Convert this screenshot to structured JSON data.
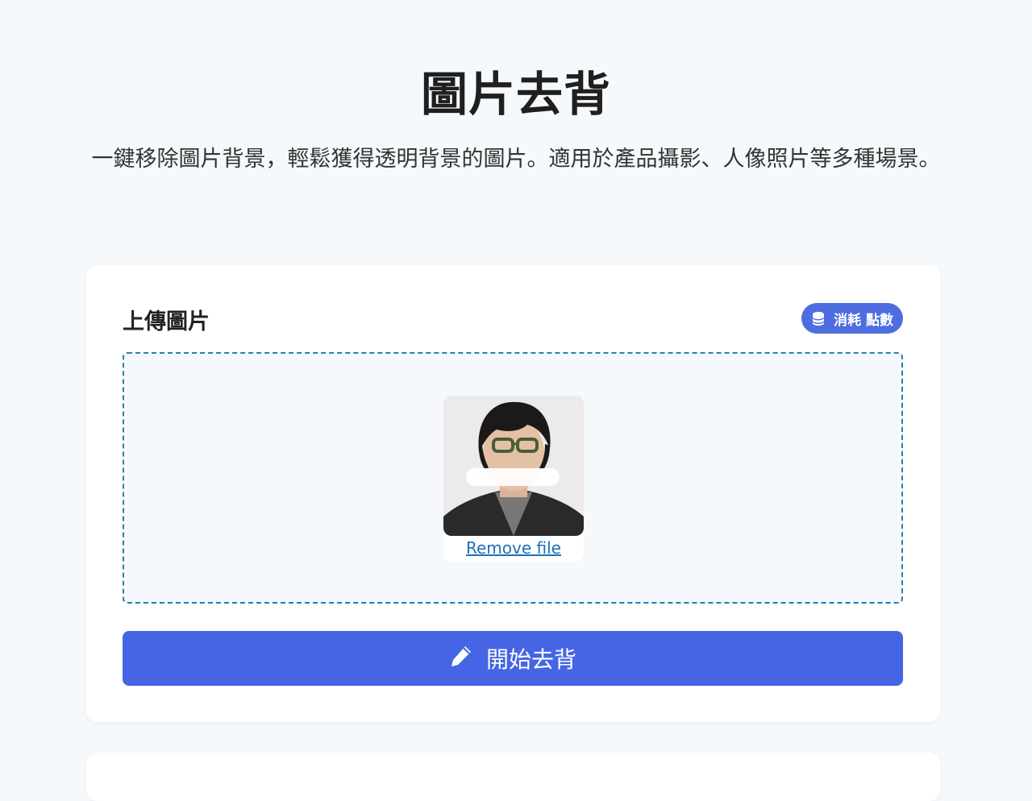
{
  "header": {
    "title": "圖片去背",
    "subtitle": "一鍵移除圖片背景，輕鬆獲得透明背景的圖片。適用於產品攝影、人像照片等多種場景。"
  },
  "upload_card": {
    "title": "上傳圖片",
    "credits_badge": {
      "label": "消耗 點數",
      "icon": "coins-icon"
    },
    "dropzone": {
      "preview_image": "uploaded-portrait-photo",
      "remove_label": "Remove file"
    },
    "start_button": {
      "label": "開始去背",
      "icon": "pencil-icon"
    }
  },
  "colors": {
    "page_background": "#f5f9fb",
    "accent": "#4565e4",
    "badge": "#4e6ee0",
    "link": "#1e6fb8",
    "dropzone_border": "#2a7fae"
  }
}
